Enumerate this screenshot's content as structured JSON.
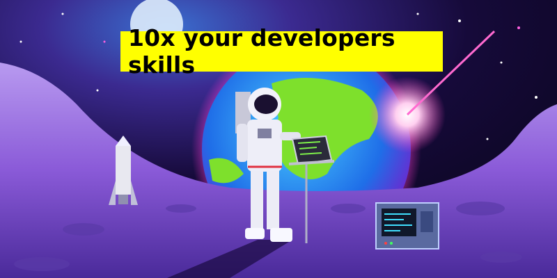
{
  "banner": {
    "headline": "10x your developers skills"
  },
  "colors": {
    "banner_bg": "#ffff00",
    "sky": "#0b0620",
    "earth_ocean": "#1f8ee8",
    "earth_land": "#7ee02c",
    "moon_surface": "#8a5ad8",
    "glow": "#ff3ad0"
  }
}
